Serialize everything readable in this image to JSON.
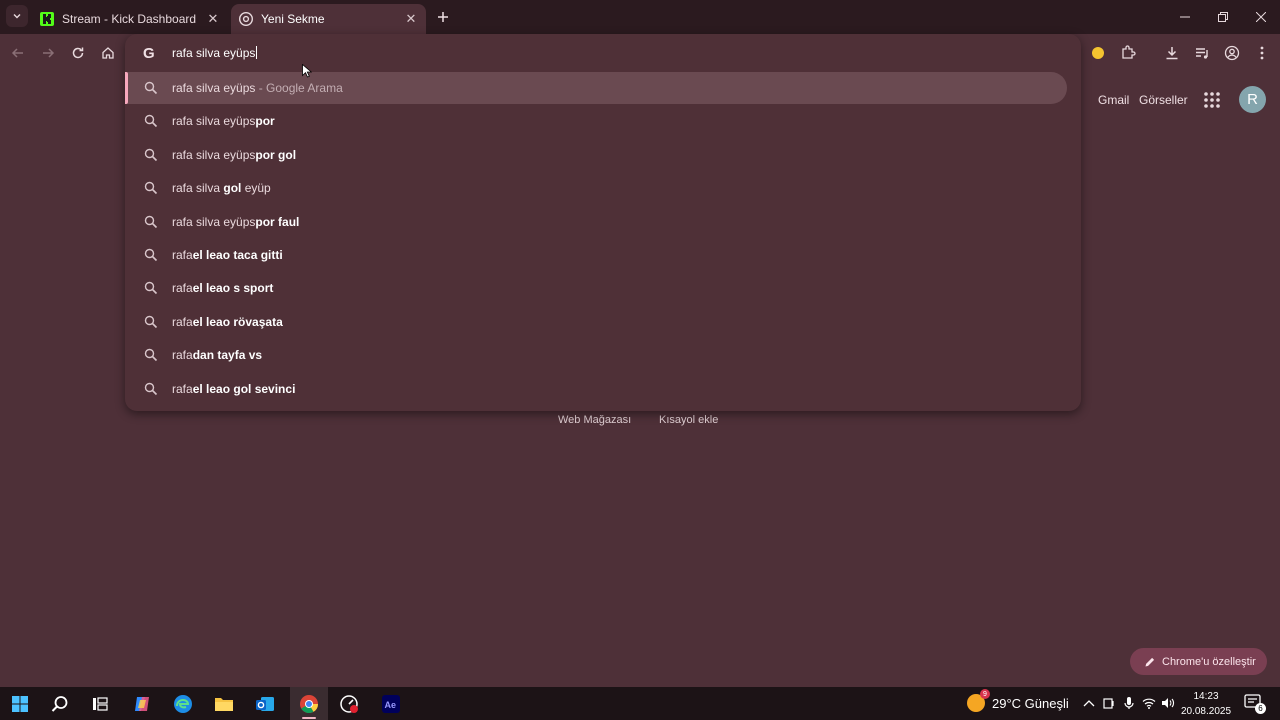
{
  "tabs": [
    {
      "title": "Stream - Kick Dashboard",
      "active": false
    },
    {
      "title": "Yeni Sekme",
      "active": true
    }
  ],
  "omnibox": {
    "value": "rafa silva eyüps",
    "suggestions": [
      {
        "typed": "rafa silva eyüps",
        "bold": "",
        "suffix": " - Google Arama"
      },
      {
        "typed": "rafa silva eyüps",
        "bold": "por",
        "suffix": ""
      },
      {
        "typed": "rafa silva eyüps",
        "bold": "por gol",
        "suffix": ""
      },
      {
        "typed": "rafa silva ",
        "bold": "gol",
        "suffix": " eyüp"
      },
      {
        "typed": "rafa silva eyüps",
        "bold": "por faul",
        "suffix": ""
      },
      {
        "typed": "rafa",
        "bold": "el leao taca gitti",
        "suffix": ""
      },
      {
        "typed": "rafa",
        "bold": "el leao s sport",
        "suffix": ""
      },
      {
        "typed": "rafa",
        "bold": "el leao rövaşata",
        "suffix": ""
      },
      {
        "typed": "rafa",
        "bold": "dan tayfa vs",
        "suffix": ""
      },
      {
        "typed": "rafa",
        "bold": "el leao gol sevinci",
        "suffix": ""
      }
    ]
  },
  "ntp": {
    "gmail": "Gmail",
    "images": "Görseller",
    "avatar_letter": "R",
    "web_store": "Web Mağazası",
    "add_shortcut": "Kısayol ekle",
    "customize": "Chrome'u özelleştir"
  },
  "taskbar": {
    "weather_temp": "29°C",
    "weather_desc": "Güneşli",
    "weather_badge": "9",
    "time": "14:23",
    "date": "20.08.2025",
    "notifications": "6"
  },
  "colors": {
    "accent": "#f7a8bd",
    "background": "#4e3038",
    "tabstrip": "#2b1a1f",
    "taskbar": "#1c1316"
  }
}
